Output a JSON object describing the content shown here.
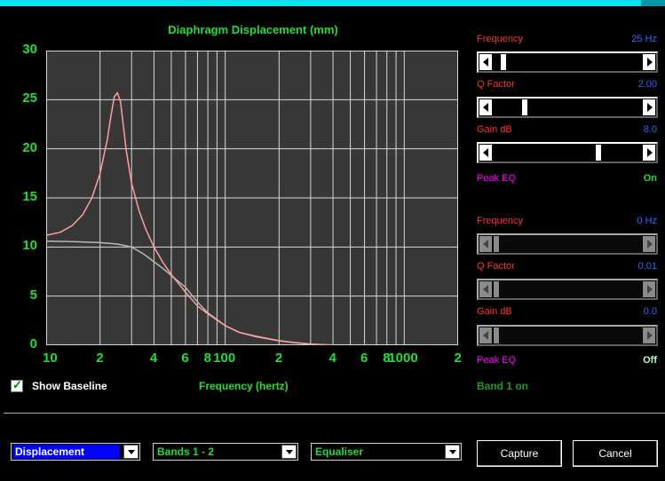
{
  "chart_data": {
    "type": "line",
    "title": "Diaphragm Displacement (mm)",
    "xlabel": "Frequency (hertz)",
    "ylabel": "",
    "x_scale": "log",
    "xlim": [
      10,
      2000
    ],
    "ylim": [
      0,
      30
    ],
    "y_ticks": [
      "0",
      "5",
      "10",
      "15",
      "20",
      "25",
      "30"
    ],
    "x_ticks": [
      "10",
      "2",
      "4",
      "6",
      "8",
      "100",
      "2",
      "4",
      "6",
      "8",
      "1000",
      "2"
    ],
    "grid": true,
    "background": "#373737",
    "series": [
      {
        "color": "#ff9fa0",
        "x": [
          10,
          12,
          14,
          16,
          18,
          20,
          22,
          23,
          24,
          25,
          26,
          27,
          28,
          30,
          33,
          36,
          40,
          45,
          50,
          60,
          70,
          80,
          100,
          120,
          150,
          200,
          250,
          300,
          400
        ],
        "y": [
          11.2,
          11.5,
          12.2,
          13.3,
          15.0,
          17.5,
          21.0,
          23.3,
          25.3,
          25.7,
          24.8,
          22.3,
          19.8,
          16.5,
          13.7,
          11.8,
          10.0,
          8.4,
          7.2,
          5.4,
          4.0,
          3.2,
          2.0,
          1.3,
          0.9,
          0.45,
          0.25,
          0.12,
          0.03
        ]
      },
      {
        "color": "#b8b8b8",
        "x": [
          10,
          14,
          20,
          25,
          30,
          35,
          40,
          45,
          50,
          60,
          70,
          80,
          100,
          120,
          150,
          200,
          250,
          300
        ],
        "y": [
          10.6,
          10.55,
          10.45,
          10.3,
          10.0,
          9.3,
          8.5,
          7.8,
          7.1,
          5.9,
          4.4,
          3.3,
          2.0,
          1.3,
          0.85,
          0.45,
          0.25,
          0.12
        ]
      }
    ]
  },
  "bands": [
    {
      "frequency_label": "Frequency",
      "frequency_value": "25 Hz",
      "q_label": "Q Factor",
      "q_value": "2.00",
      "gain_label": "Gain  dB",
      "gain_value": "8.0",
      "peak_label": "Peak EQ",
      "peak_value": "On",
      "frequency_slider_level": 0.05,
      "q_slider_level": 0.2,
      "gain_slider_level": 0.72,
      "enabled": true
    },
    {
      "frequency_label": "Frequency",
      "frequency_value": "0 Hz",
      "q_label": "Q Factor",
      "q_value": "0.01",
      "gain_label": "Gain  dB",
      "gain_value": "0.0",
      "peak_label": "Peak EQ",
      "peak_value": "Off",
      "frequency_slider_level": 0,
      "q_slider_level": 0,
      "gain_slider_level": 0,
      "enabled": false
    }
  ],
  "show_baseline": {
    "label": "Show Baseline",
    "checked": true,
    "check_glyph": "✓"
  },
  "band_status": "Band 1 on",
  "combos": {
    "view": "Displacement",
    "bands": "Bands 1 - 2",
    "mode": "Equaliser"
  },
  "buttons": {
    "capture": "Capture",
    "cancel": "Cancel"
  },
  "colors": {
    "accent_green": "#22dd33",
    "label_red": "#ff3333",
    "value_blue": "#3366ff",
    "peak_magenta": "#ff00ff",
    "top_bar_cyan": "#00e5ee"
  }
}
